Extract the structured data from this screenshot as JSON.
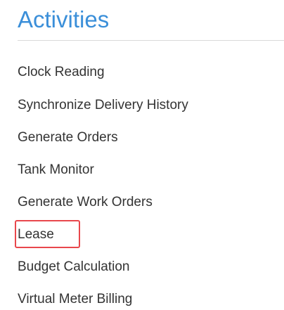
{
  "header": {
    "title": "Activities"
  },
  "activities": {
    "items": [
      {
        "label": "Clock Reading"
      },
      {
        "label": "Synchronize Delivery History"
      },
      {
        "label": "Generate Orders"
      },
      {
        "label": "Tank Monitor"
      },
      {
        "label": "Generate Work Orders"
      },
      {
        "label": "Lease"
      },
      {
        "label": "Budget Calculation"
      },
      {
        "label": "Virtual Meter Billing"
      }
    ],
    "highlighted_item": "Lease"
  },
  "colors": {
    "title": "#3b8fd9",
    "text": "#333333",
    "divider": "#d9d9d9",
    "highlight": "#e8474c"
  }
}
